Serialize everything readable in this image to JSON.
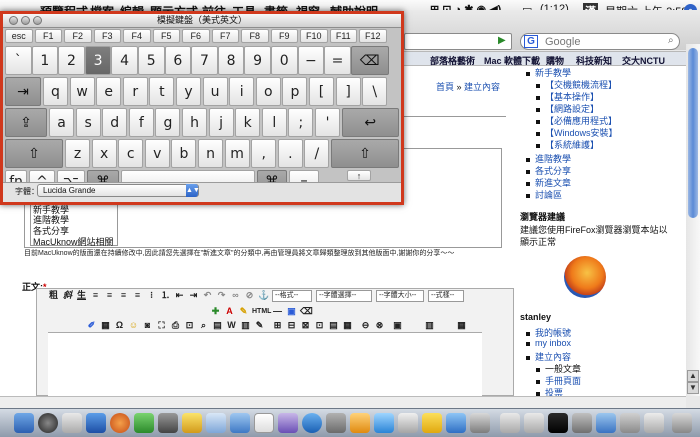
{
  "menubar": {
    "apple": "",
    "items": [
      "預覽程式",
      "檔案",
      "編輯",
      "顯示方式",
      "前往",
      "工具",
      "書籤",
      "視窗",
      "輔助說明"
    ],
    "battery": "(1:12)",
    "input_lang": "漢",
    "clock": "星期六 上午 2:58"
  },
  "browser": {
    "search_placeholder": "Google",
    "search_engine_label": "G",
    "bookmarks": [
      "部落格藝術",
      "Mac 軟體下載",
      "購物",
      "科技新知",
      "交大NCTU"
    ]
  },
  "keyboard_viewer": {
    "title": "模擬鍵盤（美式英文）",
    "function_row": [
      "esc",
      "F1",
      "F2",
      "F3",
      "F4",
      "F5",
      "F6",
      "F7",
      "F8",
      "F9",
      "F10",
      "F11",
      "F12"
    ],
    "row1": [
      "`",
      "1",
      "2",
      "3",
      "4",
      "5",
      "6",
      "7",
      "8",
      "9",
      "0",
      "−",
      "=",
      "⌫"
    ],
    "row2": [
      "⇥",
      "q",
      "w",
      "e",
      "r",
      "t",
      "y",
      "u",
      "i",
      "o",
      "p",
      "[",
      "]",
      "\\"
    ],
    "row3": [
      "⇪",
      "a",
      "s",
      "d",
      "f",
      "g",
      "h",
      "j",
      "k",
      "l",
      ";",
      "'",
      "↩"
    ],
    "row4": [
      "⇧",
      "z",
      "x",
      "c",
      "v",
      "b",
      "n",
      "m",
      ",",
      ".",
      "/",
      "⇧"
    ],
    "row5": [
      "fn",
      "^",
      "⌥",
      "⌘",
      "",
      "⌘",
      "⌅"
    ],
    "arrows": [
      "↑",
      "←",
      "↓",
      "→"
    ],
    "font_label": "字體：",
    "font_value": "Lucida Grande"
  },
  "page": {
    "breadcrumb_home": "首頁",
    "breadcrumb_sep": " » ",
    "breadcrumb_current": "建立內容",
    "left_list": [
      "新手教學",
      "進階教學",
      "各式分享",
      "MacUknow網站相關"
    ],
    "notice": "目前MacUknow的版面還在持續修改中,因此請您先選擇在\"新進文章\"的分類中,再由管理員將文章歸類整理放到其他版面中,謝謝你的分享～～",
    "body_label": "正文:",
    "required_mark": "*",
    "toolbar_selects": [
      "--格式--",
      "--字體選擇--",
      "--字體大小--",
      "--式樣--"
    ],
    "toolbar_html": "HTML"
  },
  "sidebar": {
    "nav": {
      "newbie": "新手教學",
      "newbie_sub": [
        "【交機競機流程】",
        "【基本操作】",
        "【網路設定】",
        "【必備應用程式】",
        "【Windows安裝】",
        "【系統維護】"
      ],
      "advanced": "進階教學",
      "share": "各式分享",
      "new_articles": "新進文章",
      "forum": "討論區"
    },
    "browser_title": "瀏覽器建議",
    "browser_text": "建議您使用FireFox瀏覽器瀏覽本站以顯示正常",
    "user_name": "stanley",
    "user_links": [
      "我的帳號",
      "my inbox",
      "建立內容"
    ],
    "create_sub": [
      "一般文章",
      "手冊頁面",
      "投票"
    ]
  },
  "colors": {
    "accent": "#d0381c",
    "link": "#1a4fb0",
    "pressed_key": "#7e7e7e"
  }
}
